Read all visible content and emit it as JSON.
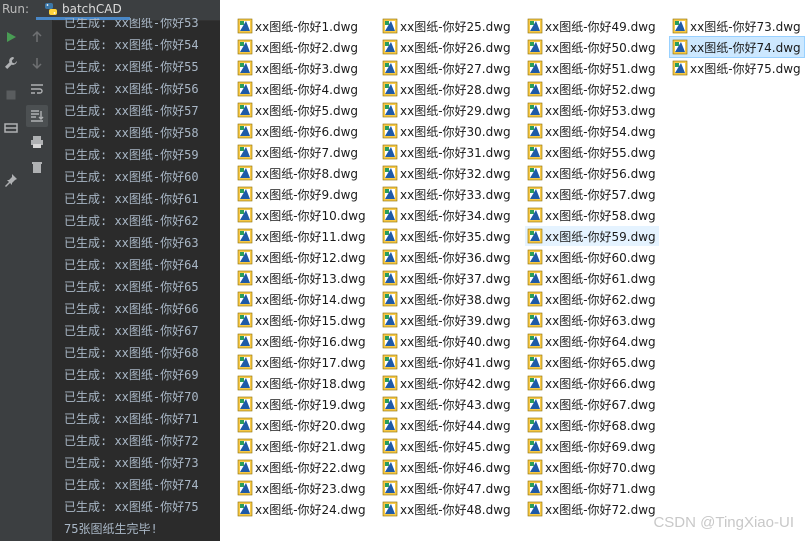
{
  "run_window": {
    "label": "Run:",
    "tab_title": "batchCAD",
    "console_lines": [
      "已生成: xx图纸-你好53",
      "已生成: xx图纸-你好54",
      "已生成: xx图纸-你好55",
      "已生成: xx图纸-你好56",
      "已生成: xx图纸-你好57",
      "已生成: xx图纸-你好58",
      "已生成: xx图纸-你好59",
      "已生成: xx图纸-你好60",
      "已生成: xx图纸-你好61",
      "已生成: xx图纸-你好62",
      "已生成: xx图纸-你好63",
      "已生成: xx图纸-你好64",
      "已生成: xx图纸-你好65",
      "已生成: xx图纸-你好66",
      "已生成: xx图纸-你好67",
      "已生成: xx图纸-你好68",
      "已生成: xx图纸-你好69",
      "已生成: xx图纸-你好70",
      "已生成: xx图纸-你好71",
      "已生成: xx图纸-你好72",
      "已生成: xx图纸-你好73",
      "已生成: xx图纸-你好74",
      "已生成: xx图纸-你好75",
      "75张图纸生完毕!"
    ],
    "toolbar_left_icons": [
      "run-icon",
      "wrench-icon",
      "stop-icon",
      "layout-icon",
      "pin-icon"
    ],
    "toolbar_right_icons": [
      "up-arrow-icon",
      "down-arrow-icon",
      "soft-wrap-icon",
      "scroll-to-end-icon",
      "print-icon",
      "trash-icon"
    ]
  },
  "file_grid": {
    "files": [
      "xx图纸-你好1.dwg",
      "xx图纸-你好2.dwg",
      "xx图纸-你好3.dwg",
      "xx图纸-你好4.dwg",
      "xx图纸-你好5.dwg",
      "xx图纸-你好6.dwg",
      "xx图纸-你好7.dwg",
      "xx图纸-你好8.dwg",
      "xx图纸-你好9.dwg",
      "xx图纸-你好10.dwg",
      "xx图纸-你好11.dwg",
      "xx图纸-你好12.dwg",
      "xx图纸-你好13.dwg",
      "xx图纸-你好14.dwg",
      "xx图纸-你好15.dwg",
      "xx图纸-你好16.dwg",
      "xx图纸-你好17.dwg",
      "xx图纸-你好18.dwg",
      "xx图纸-你好19.dwg",
      "xx图纸-你好20.dwg",
      "xx图纸-你好21.dwg",
      "xx图纸-你好22.dwg",
      "xx图纸-你好23.dwg",
      "xx图纸-你好24.dwg",
      "xx图纸-你好25.dwg",
      "xx图纸-你好26.dwg",
      "xx图纸-你好27.dwg",
      "xx图纸-你好28.dwg",
      "xx图纸-你好29.dwg",
      "xx图纸-你好30.dwg",
      "xx图纸-你好31.dwg",
      "xx图纸-你好32.dwg",
      "xx图纸-你好33.dwg",
      "xx图纸-你好34.dwg",
      "xx图纸-你好35.dwg",
      "xx图纸-你好36.dwg",
      "xx图纸-你好37.dwg",
      "xx图纸-你好38.dwg",
      "xx图纸-你好39.dwg",
      "xx图纸-你好40.dwg",
      "xx图纸-你好41.dwg",
      "xx图纸-你好42.dwg",
      "xx图纸-你好43.dwg",
      "xx图纸-你好44.dwg",
      "xx图纸-你好45.dwg",
      "xx图纸-你好46.dwg",
      "xx图纸-你好47.dwg",
      "xx图纸-你好48.dwg",
      "xx图纸-你好49.dwg",
      "xx图纸-你好50.dwg",
      "xx图纸-你好51.dwg",
      "xx图纸-你好52.dwg",
      "xx图纸-你好53.dwg",
      "xx图纸-你好54.dwg",
      "xx图纸-你好55.dwg",
      "xx图纸-你好56.dwg",
      "xx图纸-你好57.dwg",
      "xx图纸-你好58.dwg",
      "xx图纸-你好59.dwg",
      "xx图纸-你好60.dwg",
      "xx图纸-你好61.dwg",
      "xx图纸-你好62.dwg",
      "xx图纸-你好63.dwg",
      "xx图纸-你好64.dwg",
      "xx图纸-你好65.dwg",
      "xx图纸-你好66.dwg",
      "xx图纸-你好67.dwg",
      "xx图纸-你好68.dwg",
      "xx图纸-你好69.dwg",
      "xx图纸-你好70.dwg",
      "xx图纸-你好71.dwg",
      "xx图纸-你好72.dwg",
      "xx图纸-你好73.dwg",
      "xx图纸-你好74.dwg",
      "xx图纸-你好75.dwg"
    ],
    "selected_file": "xx图纸-你好74.dwg",
    "hover_file": "xx图纸-你好59.dwg",
    "file_icon": "dwg-file-icon"
  },
  "watermark": "CSDN @TingXiao-UI",
  "colors": {
    "console_bg": "#2b2b2b",
    "console_text": "#a9b7c6",
    "toolbar_bg": "#3c3f41",
    "selection_bg": "#cce8ff",
    "hover_bg": "#e5f3ff"
  }
}
